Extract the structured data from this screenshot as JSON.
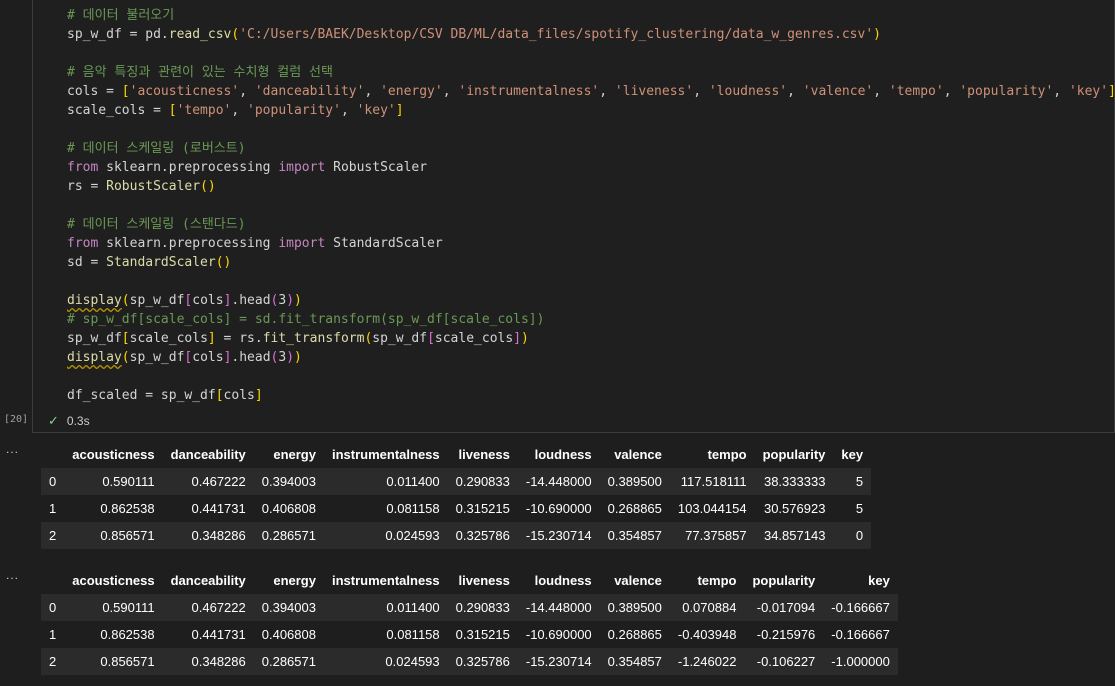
{
  "code_lines": [
    [
      {
        "t": "# 데이터 불러오기",
        "c": "cm"
      }
    ],
    [
      {
        "t": "sp_w_df = pd.",
        "c": ""
      },
      {
        "t": "read_csv",
        "c": "fn"
      },
      {
        "t": "(",
        "c": "p1"
      },
      {
        "t": "'C:/Users/BAEK/Desktop/CSV DB/ML/data_files/spotify_clustering/data_w_genres.csv'",
        "c": "str"
      },
      {
        "t": ")",
        "c": "p1"
      }
    ],
    [],
    [
      {
        "t": "# 음악 특징과 관련이 있는 수치형 컬럼 선택",
        "c": "cm"
      }
    ],
    [
      {
        "t": "cols = ",
        "c": ""
      },
      {
        "t": "[",
        "c": "p1"
      },
      {
        "t": "'acousticness'",
        "c": "str"
      },
      {
        "t": ", ",
        "c": ""
      },
      {
        "t": "'danceability'",
        "c": "str"
      },
      {
        "t": ", ",
        "c": ""
      },
      {
        "t": "'energy'",
        "c": "str"
      },
      {
        "t": ", ",
        "c": ""
      },
      {
        "t": "'instrumentalness'",
        "c": "str"
      },
      {
        "t": ", ",
        "c": ""
      },
      {
        "t": "'liveness'",
        "c": "str"
      },
      {
        "t": ", ",
        "c": ""
      },
      {
        "t": "'loudness'",
        "c": "str"
      },
      {
        "t": ", ",
        "c": ""
      },
      {
        "t": "'valence'",
        "c": "str"
      },
      {
        "t": ", ",
        "c": ""
      },
      {
        "t": "'tempo'",
        "c": "str"
      },
      {
        "t": ", ",
        "c": ""
      },
      {
        "t": "'popularity'",
        "c": "str"
      },
      {
        "t": ", ",
        "c": ""
      },
      {
        "t": "'key'",
        "c": "str"
      },
      {
        "t": "]",
        "c": "p1"
      }
    ],
    [
      {
        "t": "scale_cols = ",
        "c": ""
      },
      {
        "t": "[",
        "c": "p1"
      },
      {
        "t": "'tempo'",
        "c": "str"
      },
      {
        "t": ", ",
        "c": ""
      },
      {
        "t": "'popularity'",
        "c": "str"
      },
      {
        "t": ", ",
        "c": ""
      },
      {
        "t": "'key'",
        "c": "str"
      },
      {
        "t": "]",
        "c": "p1"
      }
    ],
    [],
    [
      {
        "t": "# 데이터 스케일링 (로버스트)",
        "c": "cm"
      }
    ],
    [
      {
        "t": "from",
        "c": "kw"
      },
      {
        "t": " sklearn.preprocessing ",
        "c": ""
      },
      {
        "t": "import",
        "c": "kw"
      },
      {
        "t": " RobustScaler",
        "c": ""
      }
    ],
    [
      {
        "t": "rs = ",
        "c": ""
      },
      {
        "t": "RobustScaler",
        "c": "fn"
      },
      {
        "t": "()",
        "c": "p1"
      }
    ],
    [],
    [
      {
        "t": "# 데이터 스케일링 (스탠다드)",
        "c": "cm"
      }
    ],
    [
      {
        "t": "from",
        "c": "kw"
      },
      {
        "t": " sklearn.preprocessing ",
        "c": ""
      },
      {
        "t": "import",
        "c": "kw"
      },
      {
        "t": " StandardScaler",
        "c": ""
      }
    ],
    [
      {
        "t": "sd = ",
        "c": ""
      },
      {
        "t": "StandardScaler",
        "c": "fn"
      },
      {
        "t": "()",
        "c": "p1"
      }
    ],
    [],
    [
      {
        "t": "display",
        "c": "fn squig"
      },
      {
        "t": "(",
        "c": "p1"
      },
      {
        "t": "sp_w_df",
        "c": ""
      },
      {
        "t": "[",
        "c": "p2"
      },
      {
        "t": "cols",
        "c": ""
      },
      {
        "t": "]",
        "c": "p2"
      },
      {
        "t": ".head",
        "c": ""
      },
      {
        "t": "(",
        "c": "p2"
      },
      {
        "t": "3",
        "c": ""
      },
      {
        "t": ")",
        "c": "p2"
      },
      {
        "t": ")",
        "c": "p1"
      }
    ],
    [
      {
        "t": "# sp_w_df[scale_cols] = sd.fit_transform(sp_w_df[scale_cols])",
        "c": "cm"
      }
    ],
    [
      {
        "t": "sp_w_df",
        "c": ""
      },
      {
        "t": "[",
        "c": "p1"
      },
      {
        "t": "scale_cols",
        "c": ""
      },
      {
        "t": "]",
        "c": "p1"
      },
      {
        "t": " = rs.",
        "c": ""
      },
      {
        "t": "fit_transform",
        "c": "fn"
      },
      {
        "t": "(",
        "c": "p1"
      },
      {
        "t": "sp_w_df",
        "c": ""
      },
      {
        "t": "[",
        "c": "p2"
      },
      {
        "t": "scale_cols",
        "c": ""
      },
      {
        "t": "]",
        "c": "p2"
      },
      {
        "t": ")",
        "c": "p1"
      }
    ],
    [
      {
        "t": "display",
        "c": "fn squig"
      },
      {
        "t": "(",
        "c": "p1"
      },
      {
        "t": "sp_w_df",
        "c": ""
      },
      {
        "t": "[",
        "c": "p2"
      },
      {
        "t": "cols",
        "c": ""
      },
      {
        "t": "]",
        "c": "p2"
      },
      {
        "t": ".head",
        "c": ""
      },
      {
        "t": "(",
        "c": "p2"
      },
      {
        "t": "3",
        "c": ""
      },
      {
        "t": ")",
        "c": "p2"
      },
      {
        "t": ")",
        "c": "p1"
      }
    ],
    [],
    [
      {
        "t": "df_scaled = sp_w_df",
        "c": ""
      },
      {
        "t": "[",
        "c": "p1"
      },
      {
        "t": "cols",
        "c": ""
      },
      {
        "t": "]",
        "c": "p1"
      }
    ]
  ],
  "cell": {
    "exec_count": "[20]",
    "status_icon": "check-icon",
    "elapsed": "0.3s"
  },
  "output_marker": "...",
  "table1": {
    "columns": [
      "acousticness",
      "danceability",
      "energy",
      "instrumentalness",
      "liveness",
      "loudness",
      "valence",
      "tempo",
      "popularity",
      "key"
    ],
    "rows": [
      {
        "index": "0",
        "values": [
          "0.590111",
          "0.467222",
          "0.394003",
          "0.011400",
          "0.290833",
          "-14.448000",
          "0.389500",
          "117.518111",
          "38.333333",
          "5"
        ]
      },
      {
        "index": "1",
        "values": [
          "0.862538",
          "0.441731",
          "0.406808",
          "0.081158",
          "0.315215",
          "-10.690000",
          "0.268865",
          "103.044154",
          "30.576923",
          "5"
        ]
      },
      {
        "index": "2",
        "values": [
          "0.856571",
          "0.348286",
          "0.286571",
          "0.024593",
          "0.325786",
          "-15.230714",
          "0.354857",
          "77.375857",
          "34.857143",
          "0"
        ]
      }
    ]
  },
  "table2": {
    "columns": [
      "acousticness",
      "danceability",
      "energy",
      "instrumentalness",
      "liveness",
      "loudness",
      "valence",
      "tempo",
      "popularity",
      "key"
    ],
    "rows": [
      {
        "index": "0",
        "values": [
          "0.590111",
          "0.467222",
          "0.394003",
          "0.011400",
          "0.290833",
          "-14.448000",
          "0.389500",
          "0.070884",
          "-0.017094",
          "-0.166667"
        ]
      },
      {
        "index": "1",
        "values": [
          "0.862538",
          "0.441731",
          "0.406808",
          "0.081158",
          "0.315215",
          "-10.690000",
          "0.268865",
          "-0.403948",
          "-0.215976",
          "-0.166667"
        ]
      },
      {
        "index": "2",
        "values": [
          "0.856571",
          "0.348286",
          "0.286571",
          "0.024593",
          "0.325786",
          "-15.230714",
          "0.354857",
          "-1.246022",
          "-0.106227",
          "-1.000000"
        ]
      }
    ]
  }
}
